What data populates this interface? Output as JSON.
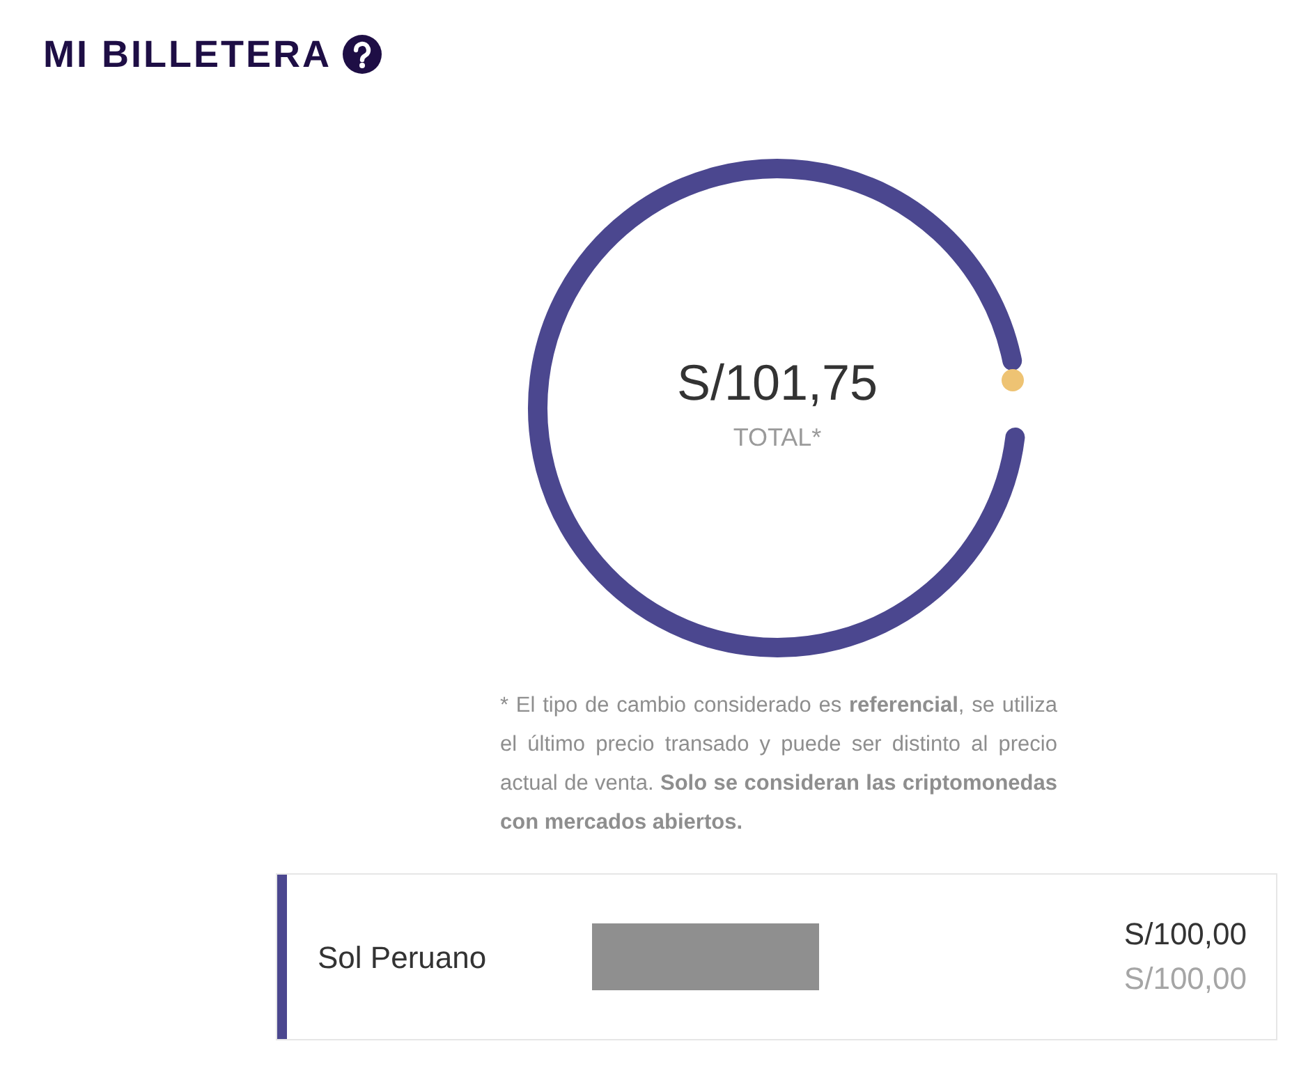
{
  "title": "MI BILLETERA",
  "total": {
    "amount": "S/101,75",
    "label": "TOTAL*"
  },
  "note": "* El tipo de cambio considerado es **referencial**, se utiliza el último precio transado y puede ser distinto al precio actual de venta. **Solo se consideran las criptomonedas con mercados abiertos.**",
  "assets": [
    {
      "name": "Sol Peruano",
      "color": "#4b478f",
      "value": "S/100,00",
      "value_converted": "S/100,00"
    }
  ]
}
